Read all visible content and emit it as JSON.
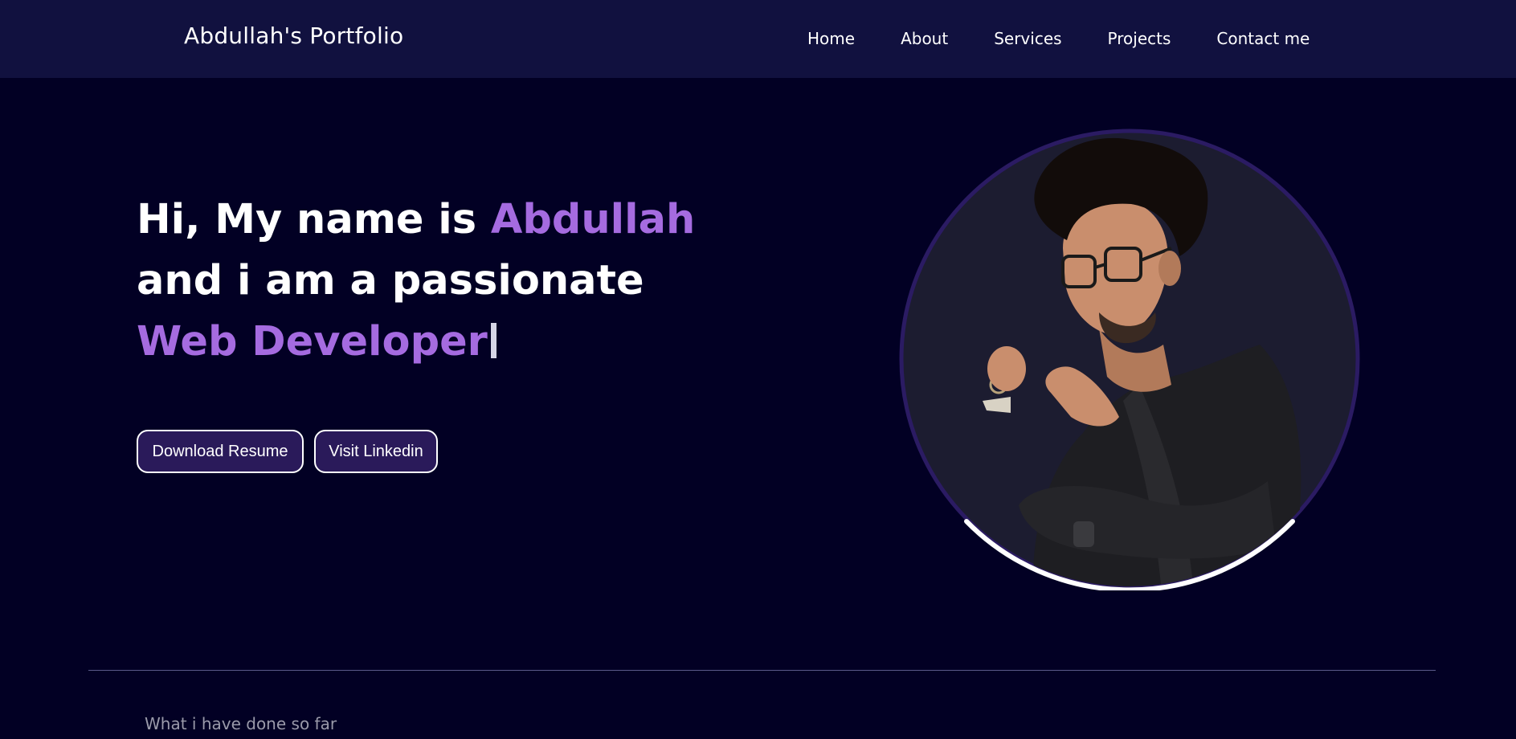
{
  "header": {
    "brand": "Abdullah's Portfolio",
    "nav": [
      "Home",
      "About",
      "Services",
      "Projects",
      "Contact me"
    ]
  },
  "hero": {
    "line1_prefix": "Hi, My name is ",
    "line1_name": "Abdullah",
    "line2": "and i am a passionate",
    "line3_role": "Web Developer",
    "buttons": {
      "resume": "Download Resume",
      "linkedin": "Visit Linkedin"
    }
  },
  "section": {
    "subtitle": "What i have done so far"
  },
  "colors": {
    "background": "#020024",
    "navbar": "#11113f",
    "accent": "#a56be0",
    "button": "#2a1a5a"
  }
}
